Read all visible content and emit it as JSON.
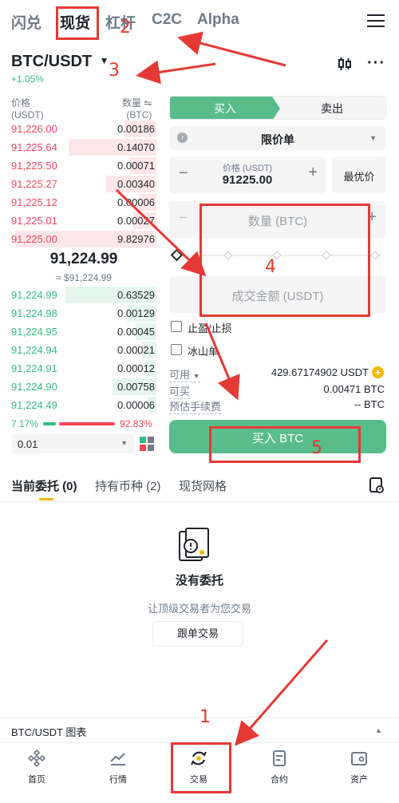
{
  "top_tabs": [
    "闪兑",
    "现货",
    "杠杆",
    "C2C",
    "Alpha"
  ],
  "pair": {
    "symbol": "BTC/USDT",
    "change": "+1.05%"
  },
  "orderbook": {
    "price_header": "价格",
    "price_unit": "(USDT)",
    "qty_header": "数量",
    "qty_unit": "(BTC)",
    "asks": [
      {
        "price": "91,226.00",
        "qty": "0.00186"
      },
      {
        "price": "91,225.64",
        "qty": "0.14070"
      },
      {
        "price": "91,225.50",
        "qty": "0.00071"
      },
      {
        "price": "91,225.27",
        "qty": "0.00340"
      },
      {
        "price": "91,225.12",
        "qty": "0.00006"
      },
      {
        "price": "91,225.01",
        "qty": "0.00027"
      },
      {
        "price": "91,225.00",
        "qty": "9.82976"
      }
    ],
    "last_price": "91,224.99",
    "last_price_usd": "≈ $91,224.99",
    "bids": [
      {
        "price": "91,224.99",
        "qty": "0.63529"
      },
      {
        "price": "91,224.98",
        "qty": "0.00129"
      },
      {
        "price": "91,224.95",
        "qty": "0.00045"
      },
      {
        "price": "91,224.94",
        "qty": "0.00021"
      },
      {
        "price": "91,224.91",
        "qty": "0.00012"
      },
      {
        "price": "91,224.90",
        "qty": "0.00758"
      },
      {
        "price": "91,224.49",
        "qty": "0.00006"
      }
    ],
    "buy_ratio": "7.17%",
    "sell_ratio": "92.83%",
    "precision": "0.01"
  },
  "order_panel": {
    "buy_tab": "买入",
    "sell_tab": "卖出",
    "order_type": "限价单",
    "price_label": "价格 (USDT)",
    "price_value": "91225.00",
    "best_price": "最优价",
    "qty_placeholder": "数量 (BTC)",
    "amount_placeholder": "成交金额 (USDT)",
    "tp_sl": "止盈/止损",
    "iceberg": "冰山单",
    "available_label": "可用",
    "available_value": "429.67174902 USDT",
    "can_buy_label": "可买",
    "can_buy_value": "0.00471 BTC",
    "fee_label": "预估手续费",
    "fee_value": "-- BTC",
    "buy_button": "买入 BTC"
  },
  "orders_tabs": [
    "当前委托 (0)",
    "持有币种 (2)",
    "现货网格"
  ],
  "empty": {
    "title": "没有委托",
    "subtitle": "让顶级交易者为您交易",
    "button": "跟单交易"
  },
  "chart_bar": "BTC/USDT 图表",
  "bottom_nav": [
    "首页",
    "行情",
    "交易",
    "合约",
    "资产"
  ],
  "annotations": [
    "1",
    "2",
    "3",
    "4",
    "5"
  ],
  "colors": {
    "buy": "#58bd8a",
    "sell": "#f6465d",
    "annotation": "#e53935"
  }
}
